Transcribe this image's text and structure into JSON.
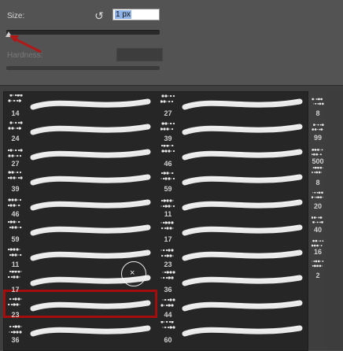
{
  "size": {
    "label": "Size:",
    "value": "1 px"
  },
  "hardness": {
    "label": "Hardness:"
  },
  "colors": {
    "accent": "#a40d0d",
    "bg": "#535353",
    "grid": "#262626"
  },
  "brushes_col1": [
    "14",
    "24",
    "27",
    "39",
    "46",
    "59",
    "11",
    "17",
    "23",
    "36"
  ],
  "brushes_col2": [
    "27",
    "39",
    "46",
    "59",
    "11",
    "17",
    "23",
    "36",
    "44",
    "60"
  ],
  "brushes_col3": [
    "8",
    "99",
    "500",
    "8",
    "20",
    "40",
    "16",
    "2"
  ],
  "selected_brush": "23"
}
